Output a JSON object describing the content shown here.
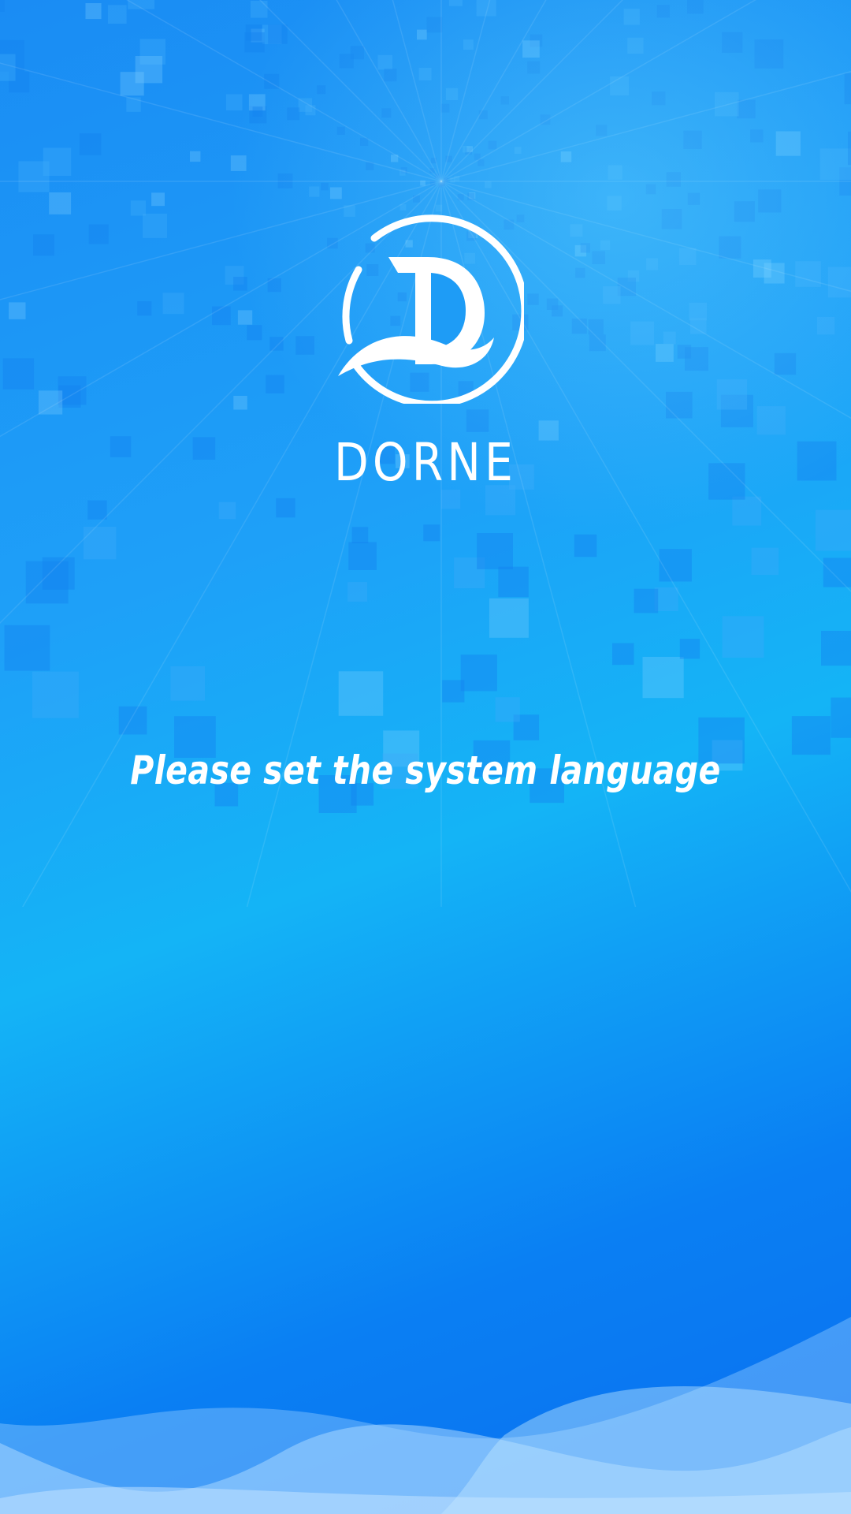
{
  "app": {
    "brand_name": "DORNE",
    "logo_icon": "dorne-d-logo-icon"
  },
  "main": {
    "prompt": "Please set the system language"
  },
  "colors": {
    "background_top": "#1a8cf4",
    "background_mid": "#14b4f6",
    "background_bottom": "#0a6ff0",
    "wave_light": "#8ccaff",
    "text": "#ffffff"
  }
}
